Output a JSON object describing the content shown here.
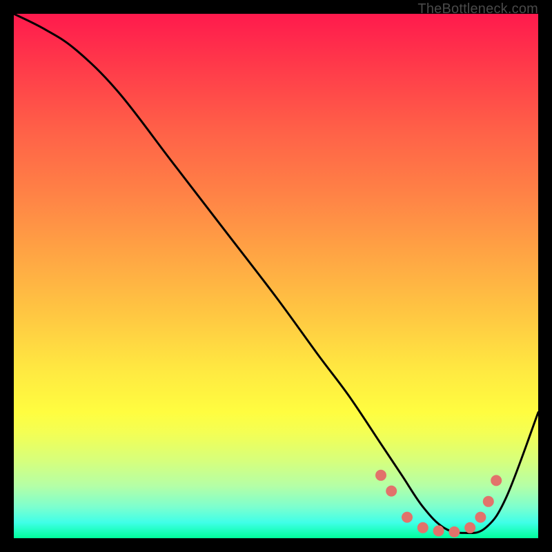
{
  "watermark": "TheBottleneck.com",
  "chart_data": {
    "type": "line",
    "title": "",
    "xlabel": "",
    "ylabel": "",
    "xlim": [
      0,
      100
    ],
    "ylim": [
      0,
      100
    ],
    "series": [
      {
        "name": "bottleneck-curve",
        "x": [
          0,
          6,
          12,
          20,
          30,
          40,
          50,
          58,
          64,
          70,
          74,
          78,
          82,
          86,
          90,
          94,
          100
        ],
        "y": [
          100,
          97,
          93,
          85,
          72,
          59,
          46,
          35,
          27,
          18,
          12,
          6,
          2,
          1,
          2,
          8,
          24
        ]
      }
    ],
    "markers": {
      "name": "optimum-dots",
      "color": "#e2726b",
      "points": [
        {
          "x": 70,
          "y": 12
        },
        {
          "x": 72,
          "y": 9
        },
        {
          "x": 75,
          "y": 4
        },
        {
          "x": 78,
          "y": 2
        },
        {
          "x": 81,
          "y": 1.4
        },
        {
          "x": 84,
          "y": 1.2
        },
        {
          "x": 87,
          "y": 2
        },
        {
          "x": 89,
          "y": 4
        },
        {
          "x": 90.5,
          "y": 7
        },
        {
          "x": 92,
          "y": 11
        }
      ]
    }
  }
}
